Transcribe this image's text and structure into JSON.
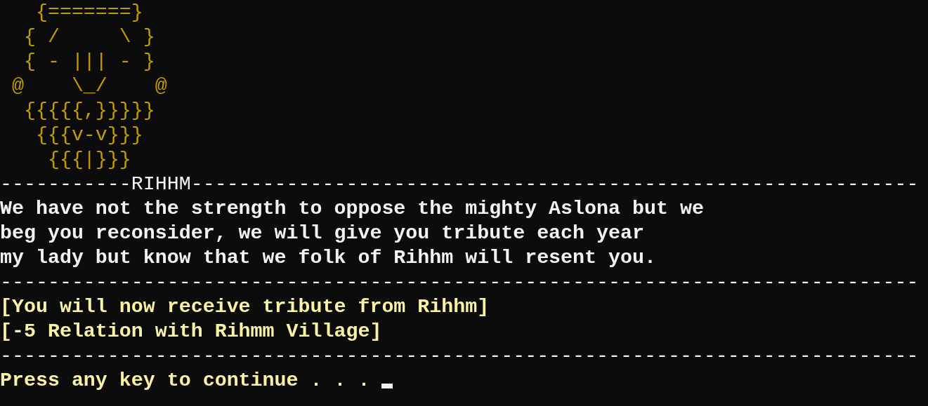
{
  "terminal": {
    "lines": [
      {
        "kind": "art",
        "text": "   {=======}"
      },
      {
        "kind": "art",
        "text": "  { /     \\ }"
      },
      {
        "kind": "art",
        "text": "  { - ||| - }"
      },
      {
        "kind": "art",
        "text": " @    \\_/    @"
      },
      {
        "kind": "art",
        "text": "  {{{{{,}}}}}"
      },
      {
        "kind": "art",
        "text": "   {{{v-v}}}"
      },
      {
        "kind": "art",
        "text": "    {{{|}}}"
      },
      {
        "kind": "rule",
        "text": "-----------RIHHM-------------------------------------------------------------"
      },
      {
        "kind": "speech",
        "text": "We have not the strength to oppose the mighty Aslona but we"
      },
      {
        "kind": "speech",
        "text": "beg you reconsider, we will give you tribute each year"
      },
      {
        "kind": "speech",
        "text": "my lady but know that we folk of Rihhm will resent you."
      },
      {
        "kind": "rule",
        "text": "-----------------------------------------------------------------------------"
      },
      {
        "kind": "notice",
        "text": "[You will now receive tribute from Rihhm]"
      },
      {
        "kind": "notice",
        "text": "[-5 Relation with Rihmm Village]"
      },
      {
        "kind": "rule",
        "text": "-----------------------------------------------------------------------------"
      },
      {
        "kind": "prompt",
        "text": "Press any key to continue . . . ",
        "cursor": true
      }
    ]
  }
}
